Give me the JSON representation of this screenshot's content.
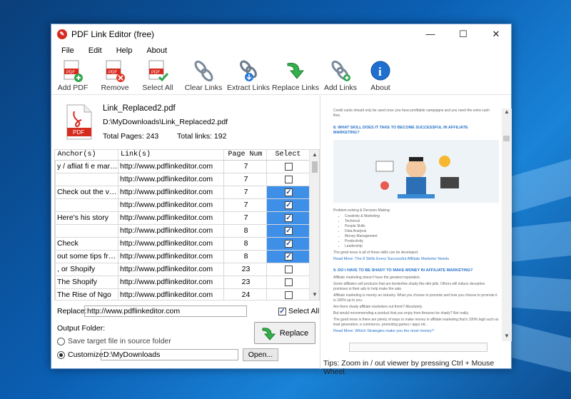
{
  "window": {
    "title": "PDF Link Editor (free)",
    "controls": {
      "minimize": "—",
      "maximize": "☐",
      "close": "✕"
    }
  },
  "menu": [
    "File",
    "Edit",
    "Help",
    "About"
  ],
  "toolbar": [
    {
      "label": "Add PDF",
      "icon": "add-pdf-icon"
    },
    {
      "label": "Remove",
      "icon": "remove-pdf-icon"
    },
    {
      "label": "Select All",
      "icon": "select-all-icon"
    },
    {
      "label": "Clear Links",
      "icon": "clear-links-icon"
    },
    {
      "label": "Extract Links",
      "icon": "extract-links-icon"
    },
    {
      "label": "Replace Links",
      "icon": "replace-links-icon"
    },
    {
      "label": "Add Links",
      "icon": "add-links-icon"
    },
    {
      "label": "About",
      "icon": "about-icon"
    }
  ],
  "file": {
    "name": "Link_Replaced2.pdf",
    "path": "D:\\MyDownloads\\Link_Replaced2.pdf",
    "total_pages": "Total Pages: 243",
    "total_links": "Total links: 192",
    "badge": "PDF"
  },
  "table": {
    "headers": [
      "Anchor(s)",
      "Link(s)",
      "Page Num",
      "Select"
    ],
    "rows": [
      {
        "anchor": "y / afliat fi e marke...",
        "link": "http://www.pdflinkeditor.com",
        "page": "7",
        "selected": false
      },
      {
        "anchor": "",
        "link": "http://www.pdflinkeditor.com",
        "page": "7",
        "selected": false
      },
      {
        "anchor": "Check out the vid...",
        "link": "http://www.pdflinkeditor.com",
        "page": "7",
        "selected": true
      },
      {
        "anchor": "",
        "link": "http://www.pdflinkeditor.com",
        "page": "7",
        "selected": true
      },
      {
        "anchor": "Here's his story",
        "link": "http://www.pdflinkeditor.com",
        "page": "7",
        "selected": true
      },
      {
        "anchor": "",
        "link": "http://www.pdflinkeditor.com",
        "page": "8",
        "selected": true
      },
      {
        "anchor": "Check",
        "link": "http://www.pdflinkeditor.com",
        "page": "8",
        "selected": true
      },
      {
        "anchor": "out some tips fro...",
        "link": "http://www.pdflinkeditor.com",
        "page": "8",
        "selected": true
      },
      {
        "anchor": ", or Shopify",
        "link": "http://www.pdflinkeditor.com",
        "page": "23",
        "selected": false
      },
      {
        "anchor": "The Shopify",
        "link": "http://www.pdflinkeditor.com",
        "page": "23",
        "selected": false
      },
      {
        "anchor": "The Rise of Ngo",
        "link": "http://www.pdflinkeditor.com",
        "page": "24",
        "selected": false
      }
    ]
  },
  "replace": {
    "label": "Replace:",
    "value": "http://www.pdflinkeditor.com",
    "select_all_label": "Select All",
    "select_all_checked": true,
    "button_label": "Replace"
  },
  "output": {
    "label": "Output Folder:",
    "option_source": "Save target file in source folder",
    "option_customize": "Customize:",
    "customize_value": "D:\\MyDownloads",
    "open_label": "Open..."
  },
  "preview": {
    "top_line": "Credit cards should only be used once you have profitable campaigns and you need the extra cash flow.",
    "heading1": "8. WHAT SKILL DOES IT TAKE TO BECOME SUCCESSFUL IN AFFILIATE MARKETING?",
    "skills_intro": "Problem-solving & Decision Making:",
    "skills": [
      "Creativity & Marketing",
      "Technical",
      "People Skills",
      "Data Analysis",
      "Money Management",
      "Productivity",
      "Leadership"
    ],
    "good_news": "The good news is all of these skills can be developed.",
    "read_more1": "Read More: The 8 Skills Every Successful Affiliate Marketer Needs",
    "heading2": "9. DO I HAVE TO BE SHADY TO MAKE MONEY IN AFFILIATE MARKETING?",
    "para1": "Affiliate marketing doesn't have the greatest reputation.",
    "para2": "Some affiliates sell products that are borderline shady like diet pills. Others will induce deceptive promises in their ads to help make the sale.",
    "para3": "Affiliate marketing is merely an industry. What you choose to promote and how you choose to promote it is 100% up to you.",
    "para4": "Are there shady affiliate marketers out there? Absolutely.",
    "para5": "But would recommending a product that you enjoy from Amazon be shady? Not really.",
    "para6": "The good news is there are plenty of ways to make money in affiliate marketing that's 100% legit such as lead generation, e-commerce, promoting games / apps etc.",
    "read_more2": "Read More: Which Strategies make you the most money?",
    "tips": "Tips: Zoom in / out viewer by pressing Ctrl + Mouse Wheel."
  },
  "colors": {
    "selected_cell": "#3d8fe8",
    "accent_blue": "#2a74c9",
    "pdf_red": "#d62b1f"
  }
}
